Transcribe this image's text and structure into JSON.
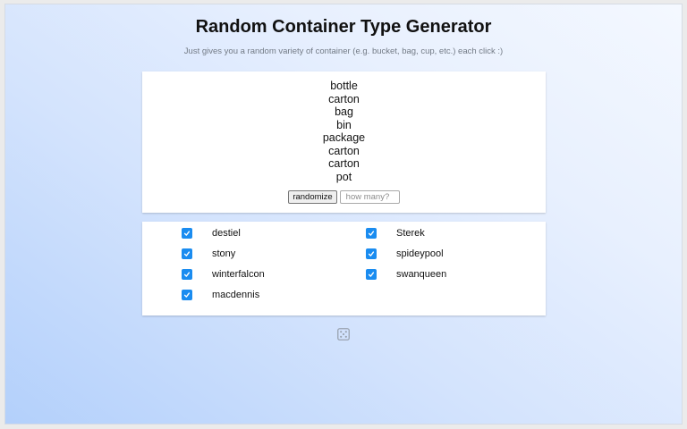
{
  "app": {
    "title": "Random Container Type Generator",
    "subtitle": "Just gives you a random variety of container (e.g. bucket, bag, cup, etc.) each click :)"
  },
  "results": [
    "bottle",
    "carton",
    "bag",
    "bin",
    "package",
    "carton",
    "carton",
    "pot"
  ],
  "controls": {
    "randomize_label": "randomize",
    "count_placeholder": "how many?",
    "count_value": ""
  },
  "users": [
    {
      "label": "destiel",
      "checked": true
    },
    {
      "label": "Sterek",
      "checked": true
    },
    {
      "label": "stony",
      "checked": true
    },
    {
      "label": "spideypool",
      "checked": true
    },
    {
      "label": "winterfalcon",
      "checked": true
    },
    {
      "label": "swanqueen",
      "checked": true
    },
    {
      "label": "macdennis",
      "checked": true
    }
  ],
  "icons": {
    "checkbox": "check-icon",
    "footer": "dice-icon"
  },
  "colors": {
    "accent": "#1a8cf0",
    "background_start": "#b3d0fb",
    "background_end": "#f4f8ff"
  }
}
